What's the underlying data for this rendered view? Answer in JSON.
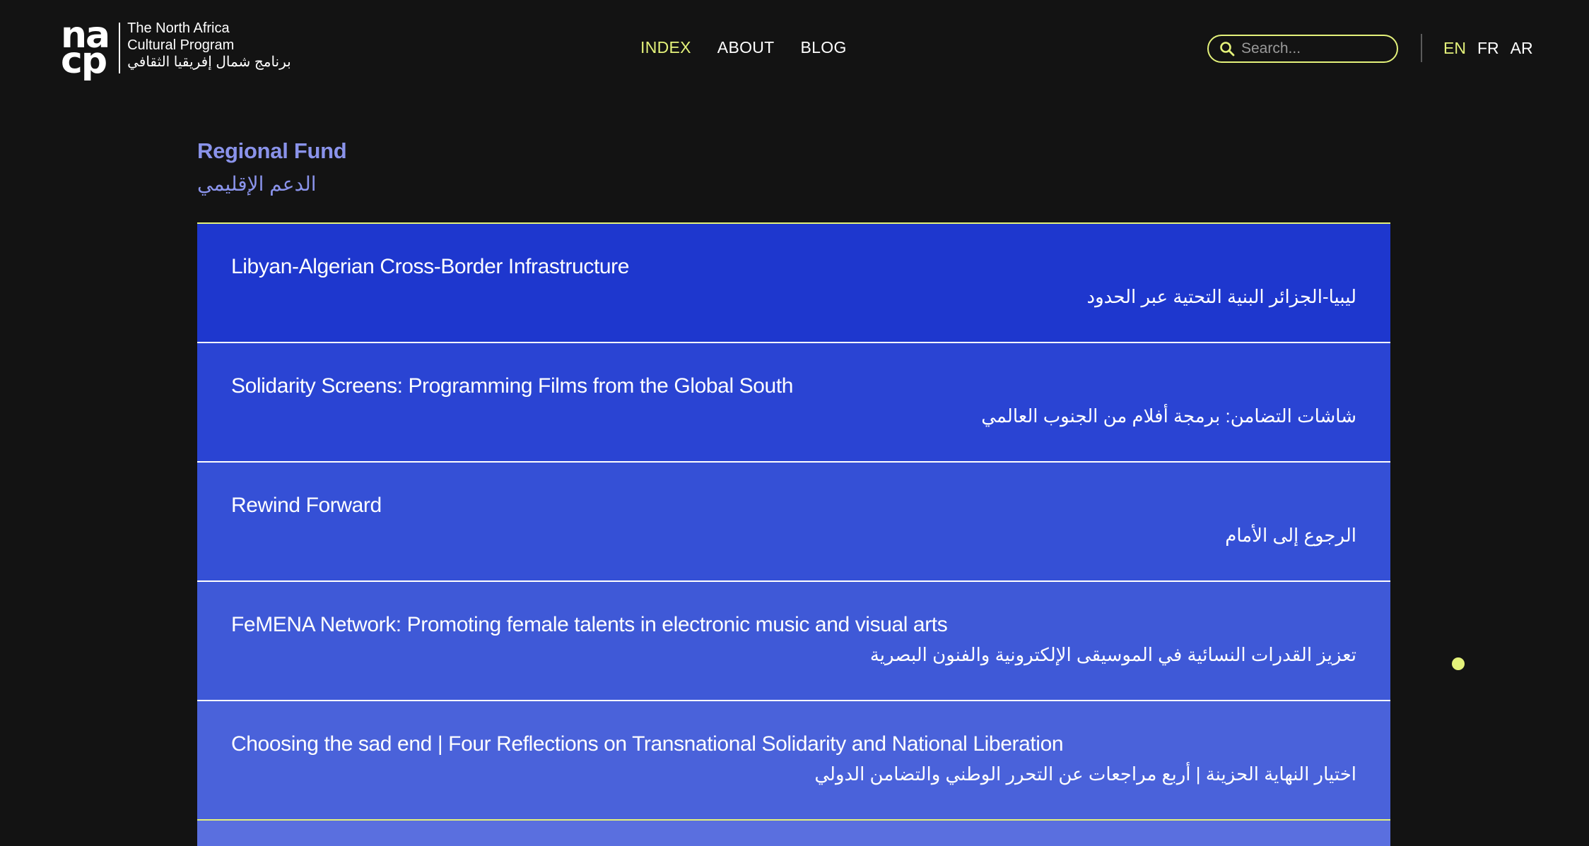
{
  "logo": {
    "mark_line1": "na",
    "mark_line2": "cp",
    "text_line1": "The North Africa",
    "text_line2": "Cultural Program",
    "text_line3_ar": "برنامج شمال إفريقيا الثقافي"
  },
  "nav": {
    "items": [
      {
        "label": "INDEX",
        "active": true
      },
      {
        "label": "ABOUT",
        "active": false
      },
      {
        "label": "BLOG",
        "active": false
      }
    ]
  },
  "search": {
    "placeholder": "Search...",
    "value": ""
  },
  "languages": [
    {
      "label": "EN",
      "active": true
    },
    {
      "label": "FR",
      "active": false
    },
    {
      "label": "AR",
      "active": false
    }
  ],
  "section": {
    "title": "Regional Fund",
    "title_ar": "الدعم الإقليمي"
  },
  "projects": [
    {
      "title": "Libyan-Algerian Cross-Border Infrastructure",
      "title_ar": "ليبيا-الجزائر البنية التحتية عبر الحدود"
    },
    {
      "title": "Solidarity Screens: Programming Films from the Global South",
      "title_ar": "شاشات التضامن: برمجة أفلام من الجنوب العالمي"
    },
    {
      "title": "Rewind Forward",
      "title_ar": "الرجوع إلى الأمام"
    },
    {
      "title": "FeMENA Network: Promoting female talents in electronic music and visual arts",
      "title_ar": "تعزيز القدرات النسائية في الموسيقى الإلكترونية والفنون البصرية"
    },
    {
      "title": "Choosing the sad end | Four Reflections on Transnational Solidarity and National Liberation",
      "title_ar": "اختيار النهاية الحزينة | أربع مراجعات عن التحرر الوطني والتضامن الدولي"
    }
  ],
  "colors": {
    "accent": "#e4f27a",
    "background": "#131313",
    "section_title": "#8a93ea",
    "row_backgrounds": [
      "#1e37ce",
      "#2a44d3",
      "#3550d6",
      "#3f59d7",
      "#4a62da",
      "#5a6fdf"
    ]
  },
  "icons": {
    "search": "magnifier-icon",
    "dot": "status-dot-icon"
  }
}
